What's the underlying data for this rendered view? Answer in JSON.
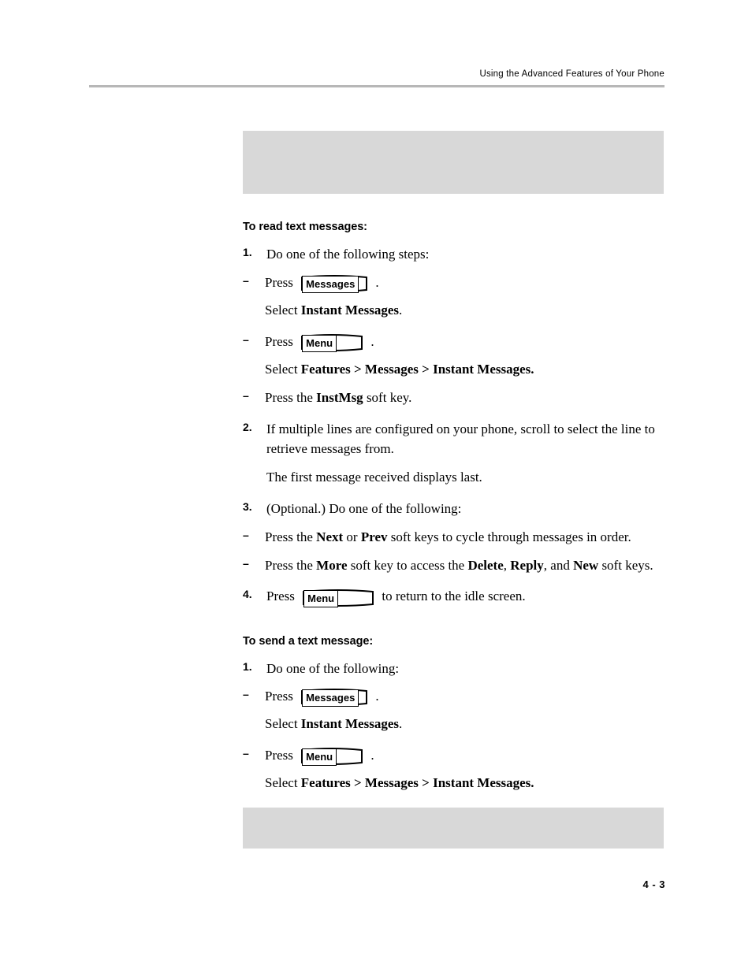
{
  "header": {
    "title": "Using the Advanced Features of Your Phone"
  },
  "footer": {
    "page_number": "4 - 3"
  },
  "keys": {
    "messages": "Messages",
    "menu": "Menu"
  },
  "sections": [
    {
      "heading": "To read text messages:",
      "steps": [
        {
          "num": "1.",
          "text": "Do one of the following steps:",
          "subs": [
            {
              "dash": "–",
              "press_label": "Press",
              "key": "Messages",
              "trailing": ".",
              "follow_plain": "Select ",
              "follow_bold": "Instant Messages",
              "follow_tail": "."
            },
            {
              "dash": "–",
              "press_label": "Press",
              "key": "Menu",
              "trailing": ".",
              "follow_plain": "Select ",
              "follow_bold": "Features > Messages > Instant Messages.",
              "follow_tail": ""
            },
            {
              "dash": "–",
              "line_pre": "Press the ",
              "line_bold": "InstMsg",
              "line_post": " soft key."
            }
          ]
        },
        {
          "num": "2.",
          "text": "If multiple lines are configured on your phone, scroll to select the line to retrieve messages from.",
          "note": "The first message received displays last."
        },
        {
          "num": "3.",
          "text": "(Optional.) Do one of the following:",
          "subs": [
            {
              "dash": "–",
              "parts_pre": "Press the ",
              "b1": "Next",
              "mid1": " or ",
              "b2": "Prev",
              "post": " soft keys to cycle through messages in order."
            },
            {
              "dash": "–",
              "parts_pre": "Press the ",
              "b1": "More",
              "mid1": " soft key to access the ",
              "b2": "Delete",
              "mid2": ", ",
              "b3": "Reply",
              "mid3": ", and ",
              "b4": "New",
              "post": " soft keys."
            }
          ]
        },
        {
          "num": "4.",
          "press_label": "Press",
          "key": "Menu",
          "tail": "to return to the idle screen."
        }
      ]
    },
    {
      "heading": "To send a text message:",
      "steps": [
        {
          "num": "1.",
          "text": "Do one of the following:",
          "subs": [
            {
              "dash": "–",
              "press_label": "Press",
              "key": "Messages",
              "trailing": ".",
              "follow_plain": "Select ",
              "follow_bold": "Instant Messages",
              "follow_tail": "."
            },
            {
              "dash": "–",
              "press_label": "Press",
              "key": "Menu",
              "trailing": ".",
              "follow_plain": "Select ",
              "follow_bold": "Features > Messages > Instant Messages.",
              "follow_tail": ""
            }
          ]
        }
      ]
    }
  ]
}
